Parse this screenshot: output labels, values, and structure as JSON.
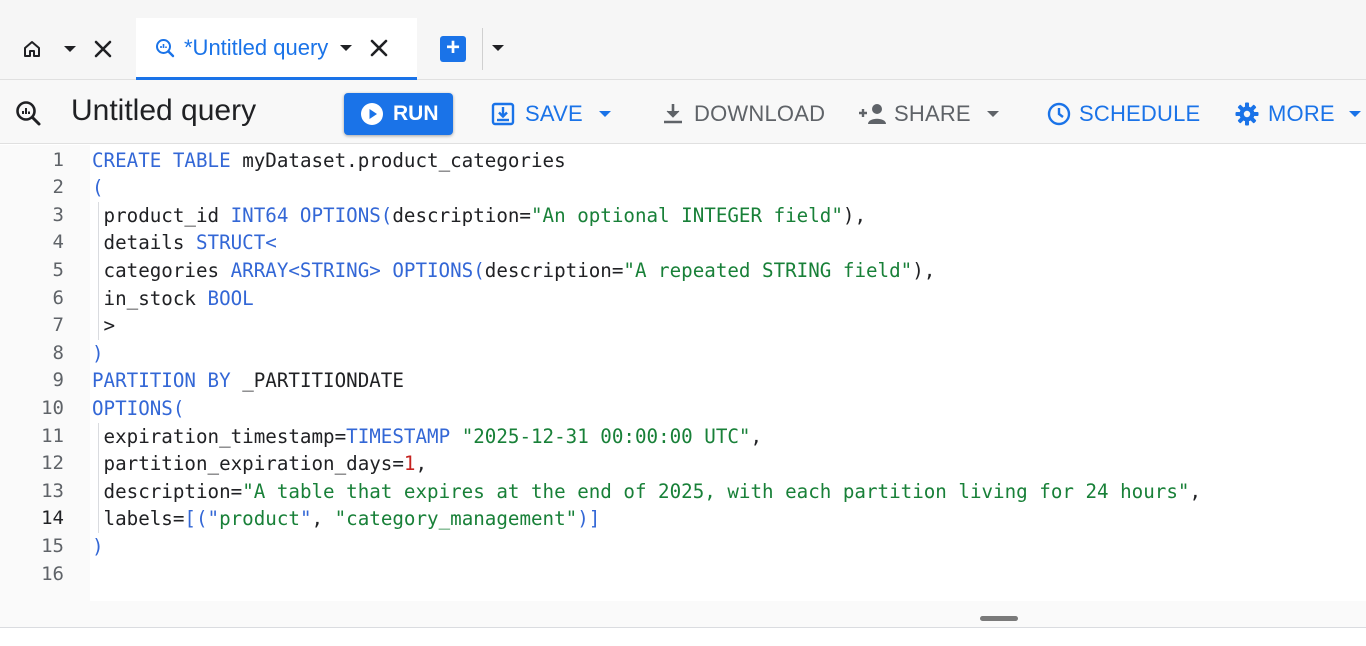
{
  "tabs": {
    "home": {
      "icon": "home-icon"
    },
    "query": {
      "title": "*Untitled query",
      "icon": "query-icon"
    }
  },
  "toolbar": {
    "title": "Untitled query",
    "run_label": "RUN",
    "save_label": "SAVE",
    "download_label": "DOWNLOAD",
    "share_label": "SHARE",
    "schedule_label": "SCHEDULE",
    "more_label": "MORE"
  },
  "colors": {
    "accent": "#1a73e8",
    "keyword": "#3367d6",
    "string": "#188038",
    "number": "#c5221f"
  },
  "editor": {
    "active_line": 14,
    "lines": [
      {
        "n": "1",
        "tokens": [
          [
            "kw",
            "CREATE TABLE "
          ],
          [
            "id",
            "myDataset.product_categories"
          ]
        ]
      },
      {
        "n": "2",
        "tokens": [
          [
            "kw",
            "("
          ]
        ]
      },
      {
        "n": "3",
        "tokens": [
          [
            "id",
            " product_id "
          ],
          [
            "kw",
            "INT64 OPTIONS("
          ],
          [
            "id",
            "description="
          ],
          [
            "str",
            "\"An optional INTEGER field\""
          ],
          [
            "pn",
            "),"
          ]
        ]
      },
      {
        "n": "4",
        "tokens": [
          [
            "id",
            " details "
          ],
          [
            "kw",
            "STRUCT<"
          ]
        ]
      },
      {
        "n": "5",
        "tokens": [
          [
            "id",
            " categories "
          ],
          [
            "kw",
            "ARRAY<STRING> OPTIONS("
          ],
          [
            "id",
            "description="
          ],
          [
            "str",
            "\"A repeated STRING field\""
          ],
          [
            "pn",
            "),"
          ]
        ]
      },
      {
        "n": "6",
        "tokens": [
          [
            "id",
            " in_stock "
          ],
          [
            "kw",
            "BOOL"
          ]
        ]
      },
      {
        "n": "7",
        "tokens": [
          [
            "id",
            " >"
          ]
        ]
      },
      {
        "n": "8",
        "tokens": [
          [
            "kw",
            ")"
          ]
        ]
      },
      {
        "n": "9",
        "tokens": [
          [
            "kw",
            "PARTITION BY "
          ],
          [
            "id",
            "_PARTITIONDATE"
          ]
        ]
      },
      {
        "n": "10",
        "tokens": [
          [
            "kw",
            "OPTIONS("
          ]
        ]
      },
      {
        "n": "11",
        "tokens": [
          [
            "id",
            " expiration_timestamp="
          ],
          [
            "kw",
            "TIMESTAMP "
          ],
          [
            "str",
            "\"2025-12-31 00:00:00 UTC\""
          ],
          [
            "pn",
            ","
          ]
        ]
      },
      {
        "n": "12",
        "tokens": [
          [
            "id",
            " partition_expiration_days="
          ],
          [
            "num",
            "1"
          ],
          [
            "pn",
            ","
          ]
        ]
      },
      {
        "n": "13",
        "tokens": [
          [
            "id",
            " description="
          ],
          [
            "str",
            "\"A table that expires at the end of 2025, with each partition living for 24 hours\""
          ],
          [
            "pn",
            ","
          ]
        ]
      },
      {
        "n": "14",
        "tokens": [
          [
            "id",
            " labels="
          ],
          [
            "kw",
            "[(\""
          ],
          [
            "str",
            "product"
          ],
          [
            "kw",
            "\""
          ],
          [
            "pn",
            ", "
          ],
          [
            "str",
            "\"category_management\""
          ],
          [
            "kw",
            ")]"
          ]
        ]
      },
      {
        "n": "15",
        "tokens": [
          [
            "kw",
            ")"
          ]
        ]
      },
      {
        "n": "16",
        "tokens": []
      }
    ]
  }
}
